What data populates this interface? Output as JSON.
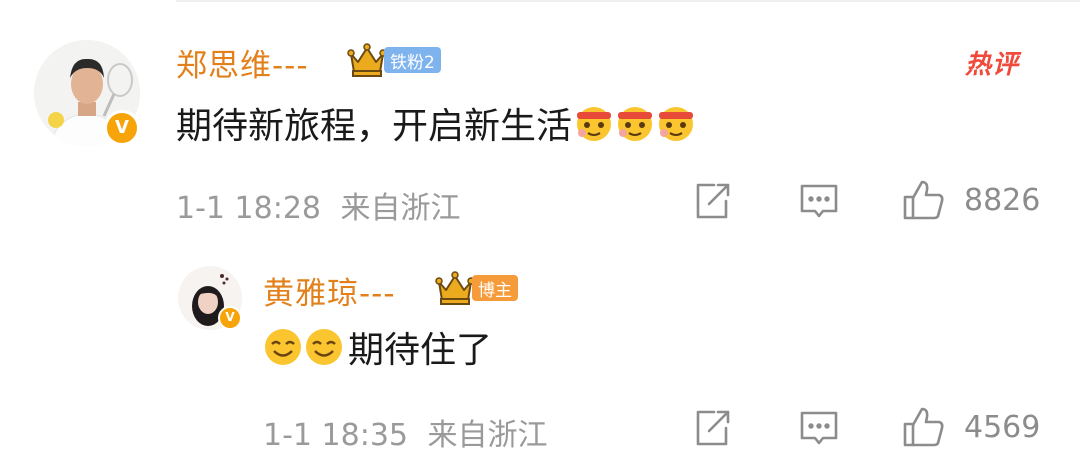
{
  "main_comment": {
    "username": "郑思维---",
    "fan_badge": "铁粉2",
    "hot_tag": "热评",
    "text": "期待新旅程，开启新生活",
    "emoji_icons": [
      "sweat-headband-emoji",
      "sweat-headband-emoji",
      "sweat-headband-emoji"
    ],
    "time": "1-1 18:28",
    "location": "来自浙江",
    "likes": "8826"
  },
  "reply": {
    "username": "黄雅琼---",
    "fan_badge": "博主",
    "text": "期待住了",
    "emoji_icons": [
      "smile-emoji",
      "smile-emoji"
    ],
    "time": "1-1 18:35",
    "location": "来自浙江",
    "likes": "4569"
  },
  "colors": {
    "username": "#e2811c",
    "fan_badge_blue": "#7fb3ee",
    "fan_badge_orange": "#f59b3a",
    "hot_tag": "#f04a3c",
    "verified": "#f7a40b",
    "meta_text": "#9a9a9a"
  },
  "icons": {
    "verified": "verified-v-icon",
    "crown": "crown-icon",
    "share": "share-icon",
    "comment": "comment-icon",
    "like": "like-icon"
  }
}
